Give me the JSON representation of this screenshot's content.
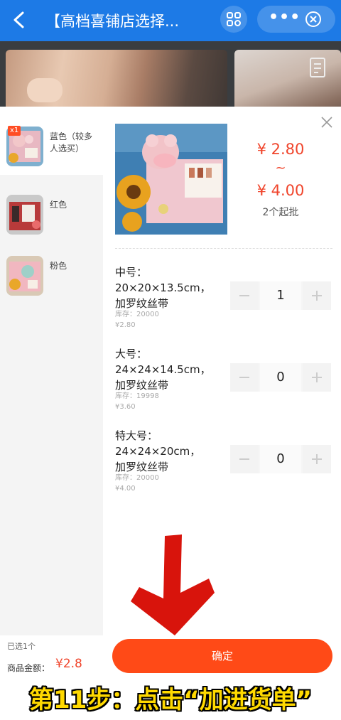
{
  "header": {
    "title": "【高档喜铺店选择...",
    "back_icon": "chevron-left-icon",
    "scan_icon": "scan-icon",
    "more_label": "•••",
    "close_icon": "close-circle-icon"
  },
  "product": {
    "price_low": "¥ 2.80",
    "price_sep": "~",
    "price_high": "¥ 4.00",
    "moq": "2个起批"
  },
  "variants": [
    {
      "label": "蓝色（较多人选买）",
      "badge": "x1",
      "active": true
    },
    {
      "label": "红色",
      "active": false
    },
    {
      "label": "粉色",
      "active": false
    }
  ],
  "specs": [
    {
      "name": "中号：20×20×13.5cm，加罗纹丝带",
      "stock": "库存：20000",
      "price": "¥2.80",
      "qty": "1"
    },
    {
      "name": "大号：24×24×14.5cm，加罗纹丝带",
      "stock": "库存：19998",
      "price": "¥3.60",
      "qty": "0"
    },
    {
      "name": "特大号：24×24×20cm，加罗纹丝带",
      "stock": "库存：20000",
      "price": "¥4.00",
      "qty": "0"
    }
  ],
  "footer": {
    "selected_count": "已选1个",
    "amount_label": "商品金额：",
    "amount_value": "¥2.8",
    "confirm_label": "确定"
  },
  "caption": "第11步：点击“加进货单”",
  "colors": {
    "topbar": "#1d7ae6",
    "accent": "#f0452c",
    "confirm": "#ff4a17",
    "caption": "#ffd900"
  }
}
